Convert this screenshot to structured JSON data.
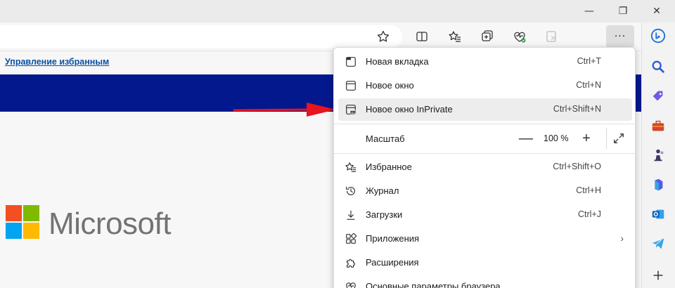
{
  "window": {
    "minimize": "—",
    "restore": "❐",
    "close": "✕"
  },
  "toolbar": {
    "more_label": "···"
  },
  "favorites_bar": {
    "link": "Управление избранным"
  },
  "page": {
    "brand": "Microsoft",
    "band_color": "#03188c"
  },
  "menu": {
    "items": [
      {
        "label": "Новая вкладка",
        "shortcut": "Ctrl+T",
        "icon": "new-tab-icon"
      },
      {
        "label": "Новое окно",
        "shortcut": "Ctrl+N",
        "icon": "new-window-icon"
      },
      {
        "label": "Новое окно InPrivate",
        "shortcut": "Ctrl+Shift+N",
        "icon": "inprivate-icon"
      }
    ],
    "zoom": {
      "label": "Масштаб",
      "minus": "—",
      "value": "100 %",
      "plus": "+"
    },
    "items2": [
      {
        "label": "Избранное",
        "shortcut": "Ctrl+Shift+O",
        "icon": "favorites-icon"
      },
      {
        "label": "Журнал",
        "shortcut": "Ctrl+H",
        "icon": "history-icon"
      },
      {
        "label": "Загрузки",
        "shortcut": "Ctrl+J",
        "icon": "downloads-icon"
      },
      {
        "label": "Приложения",
        "shortcut": "",
        "icon": "apps-icon"
      },
      {
        "label": "Расширения",
        "shortcut": "",
        "icon": "extensions-icon"
      },
      {
        "label": "Основные параметры браузера",
        "shortcut": "",
        "icon": "essentials-icon"
      }
    ],
    "chevron": "›"
  },
  "colors": {
    "accent": "#0b4fa3",
    "arrow": "#e8141e"
  }
}
